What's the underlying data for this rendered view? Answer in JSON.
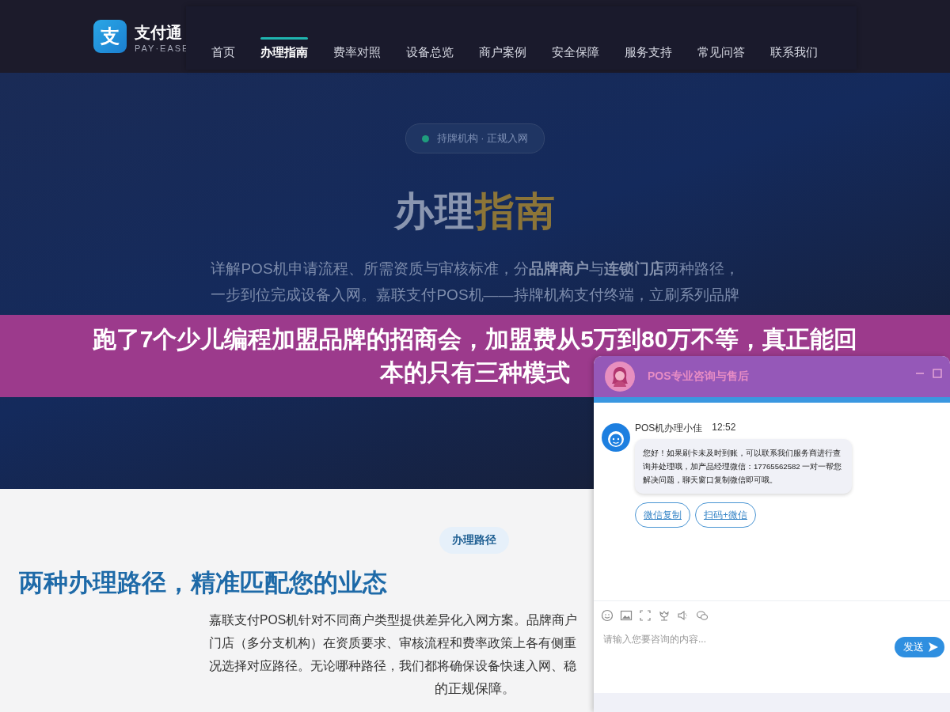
{
  "header": {
    "logo_mark": "支",
    "brand": "支付通",
    "brand_sub": "PAY·EASE",
    "nav": [
      {
        "label": "首页",
        "selected": false
      },
      {
        "label": "办理指南",
        "selected": true
      },
      {
        "label": "费率对照",
        "selected": false
      },
      {
        "label": "设备总览",
        "selected": false
      },
      {
        "label": "商户案例",
        "selected": false
      },
      {
        "label": "安全保障",
        "selected": false
      },
      {
        "label": "服务支持",
        "selected": false
      },
      {
        "label": "常见问答",
        "selected": false
      },
      {
        "label": "联系我们",
        "selected": false
      }
    ]
  },
  "hero": {
    "badge": "持牌机构 · 正规入网",
    "title": "办理",
    "title_highlight": "指南",
    "intro": "详解POS机申请流程、所需资质与审核标准，分**品牌商户**与**连锁门店**两种路径，一步到位完成设备入网。嘉联支付POS机——持牌机构支付终端，立刷系列品牌"
  },
  "section": {
    "tag": "办理路径",
    "heading": "两种办理路径，精准匹配您的业态",
    "body_lines": [
      "嘉联支付POS机针对不同商户类型提供差异化入网方案。品牌商户",
      "门店（多分支机构）在资质要求、审核流程和费率政策上各有侧重",
      "况选择对应路径。无论哪种路径，我们都将确保设备快速入网、稳"
    ],
    "body_tail": "的正规保障。"
  },
  "banner": {
    "headline_lines": [
      "跑了7个少儿编程加盟品牌的招商会，加盟费从5万到80万不等，真正能回",
      "本的只有三种模式"
    ]
  },
  "chat": {
    "title": "POS专业咨询与售后",
    "agent": "POS机办理小佳",
    "time": "12:52",
    "message": "您好！如果刷卡未及时到账，可以联系我们服务商进行查询并处理哦，加产品经理微信：17765562582 一对一帮您解决问题，聊天窗口复制微信即可哦。",
    "actions": [
      "微信复制",
      "扫码+微信"
    ],
    "placeholder": "请输入您要咨询的内容...",
    "send": "发送"
  }
}
